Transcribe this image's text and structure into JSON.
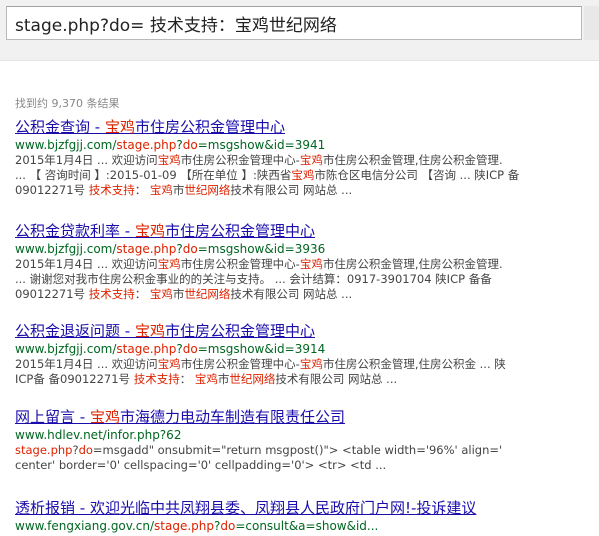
{
  "search": {
    "query": "stage.php?do= 技术支持：宝鸡世纪网络"
  },
  "stats": "找到约 9,370 条结果",
  "results": [
    {
      "title_parts": [
        {
          "t": "公积金查询 - ",
          "hl": false
        },
        {
          "t": "宝鸡",
          "hl": true
        },
        {
          "t": "市住房公积金管理中心",
          "hl": false
        }
      ],
      "url_parts": [
        {
          "t": "www.bjzfgjj.com/",
          "hl": false
        },
        {
          "t": "stage.php",
          "hl": true
        },
        {
          "t": "?",
          "hl": false
        },
        {
          "t": "do",
          "hl": true
        },
        {
          "t": "=msgshow&id=3941",
          "hl": false
        }
      ],
      "snippet_lines": [
        [
          {
            "t": "2015年1月4日 ... 欢迎访问",
            "hl": false
          },
          {
            "t": "宝鸡",
            "hl": true
          },
          {
            "t": "市住房公积金管理中心-",
            "hl": false
          },
          {
            "t": "宝鸡",
            "hl": true
          },
          {
            "t": "市住房公积金管理,住房公积金管理.",
            "hl": false
          }
        ],
        [
          {
            "t": "... 【 咨询时间 】:2015-01-09 【所在单位 】:陕西省",
            "hl": false
          },
          {
            "t": "宝鸡",
            "hl": true
          },
          {
            "t": "市陈仓区电信分公司 【咨询 ... 陕ICP 备",
            "hl": false
          }
        ],
        [
          {
            "t": "09012271号 ",
            "hl": false
          },
          {
            "t": "技术支持",
            "hl": true
          },
          {
            "t": "： ",
            "hl": false
          },
          {
            "t": "宝鸡",
            "hl": true
          },
          {
            "t": "市",
            "hl": false
          },
          {
            "t": "世纪网络",
            "hl": true
          },
          {
            "t": "技术有限公司 网站总 ...",
            "hl": false
          }
        ]
      ]
    },
    {
      "title_parts": [
        {
          "t": "公积金贷款利率 - ",
          "hl": false
        },
        {
          "t": "宝鸡",
          "hl": true
        },
        {
          "t": "市住房公积金管理中心",
          "hl": false
        }
      ],
      "url_parts": [
        {
          "t": "www.bjzfgjj.com/",
          "hl": false
        },
        {
          "t": "stage.php",
          "hl": true
        },
        {
          "t": "?",
          "hl": false
        },
        {
          "t": "do",
          "hl": true
        },
        {
          "t": "=msgshow&id=3936",
          "hl": false
        }
      ],
      "snippet_lines": [
        [
          {
            "t": "2015年1月4日 ... 欢迎访问",
            "hl": false
          },
          {
            "t": "宝鸡",
            "hl": true
          },
          {
            "t": "市住房公积金管理中心-",
            "hl": false
          },
          {
            "t": "宝鸡",
            "hl": true
          },
          {
            "t": "市住房公积金管理,住房公积金管理.",
            "hl": false
          }
        ],
        [
          {
            "t": "... 谢谢您对我市住房公积金事业的的关注与支持。 ... 会计结算：0917-3901704 陕ICP 备备",
            "hl": false
          }
        ],
        [
          {
            "t": "09012271号 ",
            "hl": false
          },
          {
            "t": "技术支持",
            "hl": true
          },
          {
            "t": "： ",
            "hl": false
          },
          {
            "t": "宝鸡",
            "hl": true
          },
          {
            "t": "市",
            "hl": false
          },
          {
            "t": "世纪网络",
            "hl": true
          },
          {
            "t": "技术有限公司 网站总 ...",
            "hl": false
          }
        ]
      ]
    },
    {
      "title_parts": [
        {
          "t": "公积金退返问题 - ",
          "hl": false
        },
        {
          "t": "宝鸡",
          "hl": true
        },
        {
          "t": "市住房公积金管理中心",
          "hl": false
        }
      ],
      "url_parts": [
        {
          "t": "www.bjzfgjj.com/",
          "hl": false
        },
        {
          "t": "stage.php",
          "hl": true
        },
        {
          "t": "?",
          "hl": false
        },
        {
          "t": "do",
          "hl": true
        },
        {
          "t": "=msgshow&id=3914",
          "hl": false
        }
      ],
      "snippet_lines": [
        [
          {
            "t": "2015年1月4日 ... 欢迎访问",
            "hl": false
          },
          {
            "t": "宝鸡",
            "hl": true
          },
          {
            "t": "市住房公积金管理中心-",
            "hl": false
          },
          {
            "t": "宝鸡",
            "hl": true
          },
          {
            "t": "市住房公积金管理,住房公积金 ... 陕",
            "hl": false
          }
        ],
        [
          {
            "t": "ICP备 备09012271号 ",
            "hl": false
          },
          {
            "t": "技术支持",
            "hl": true
          },
          {
            "t": "： ",
            "hl": false
          },
          {
            "t": "宝鸡",
            "hl": true
          },
          {
            "t": "市",
            "hl": false
          },
          {
            "t": "世纪网络",
            "hl": true
          },
          {
            "t": "技术有限公司 网站总 ...",
            "hl": false
          }
        ]
      ]
    },
    {
      "title_parts": [
        {
          "t": "网上留言 - ",
          "hl": false
        },
        {
          "t": "宝鸡",
          "hl": true
        },
        {
          "t": "市海德力电动车制造有限责任公司",
          "hl": false
        }
      ],
      "url_parts": [
        {
          "t": "www.hdlev.net/infor.php?62",
          "hl": false
        }
      ],
      "snippet_lines": [
        [
          {
            "t": "stage.php",
            "hl": true
          },
          {
            "t": "?",
            "hl": false
          },
          {
            "t": "do",
            "hl": true
          },
          {
            "t": "=msgadd\" onsubmit=\"return msgpost()\"> <table width='96%' align='",
            "hl": false
          }
        ],
        [
          {
            "t": "center' border='0' cellspacing='0' cellpadding='0'> <tr> <td ...",
            "hl": false
          }
        ]
      ]
    },
    {
      "title_parts": [
        {
          "t": "透析报销 - 欢迎光临中共凤翔县委、凤翔县人民政府门户网!-投诉建议",
          "hl": false
        }
      ],
      "url_parts": [
        {
          "t": "www.fengxiang.gov.cn/",
          "hl": false
        },
        {
          "t": "stage.php",
          "hl": true
        },
        {
          "t": "?",
          "hl": false
        },
        {
          "t": "do",
          "hl": true
        },
        {
          "t": "=consult&a=show&id...",
          "hl": false
        }
      ],
      "snippet_lines": []
    }
  ]
}
